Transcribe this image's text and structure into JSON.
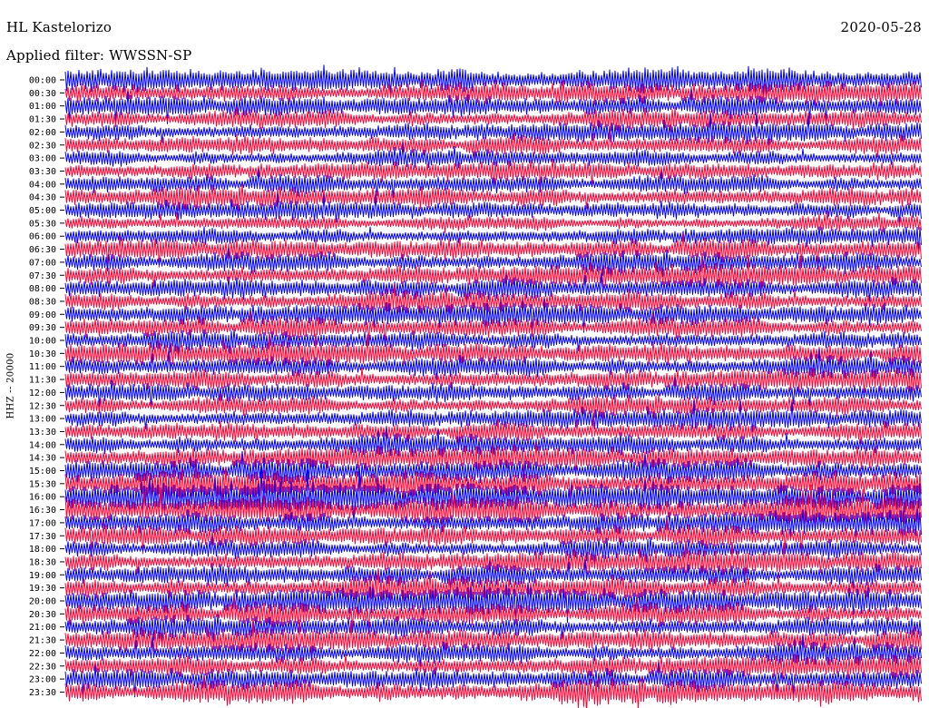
{
  "header": {
    "station": "HL Kastelorizo",
    "date": "2020-05-28",
    "filter": "Applied filter: WWSSN-SP"
  },
  "chart_data": {
    "type": "line",
    "ylabel": "HHZ -- 20000",
    "row_labels": [
      "00:00",
      "00:30",
      "01:00",
      "01:30",
      "02:00",
      "02:30",
      "03:00",
      "03:30",
      "04:00",
      "04:30",
      "05:00",
      "05:30",
      "06:00",
      "06:30",
      "07:00",
      "07:30",
      "08:00",
      "08:30",
      "09:00",
      "09:30",
      "10:00",
      "10:30",
      "11:00",
      "11:30",
      "12:00",
      "12:30",
      "13:00",
      "13:30",
      "14:00",
      "14:30",
      "15:00",
      "15:30",
      "16:00",
      "16:30",
      "17:00",
      "17:30",
      "18:00",
      "18:30",
      "19:00",
      "19:30",
      "20:00",
      "20:30",
      "21:00",
      "21:30",
      "22:00",
      "22:30",
      "23:00",
      "23:30"
    ],
    "colors": [
      "#0000ff",
      "#ff0033"
    ],
    "row_amplitude": [
      1.3,
      1.0,
      1.0,
      0.9,
      0.9,
      0.9,
      0.8,
      0.8,
      0.9,
      1.0,
      0.8,
      0.7,
      0.8,
      1.0,
      1.0,
      1.0,
      1.0,
      1.0,
      1.0,
      1.0,
      0.9,
      1.0,
      1.0,
      1.0,
      0.9,
      0.9,
      0.9,
      0.9,
      1.0,
      1.0,
      1.2,
      1.3,
      1.4,
      1.4,
      1.1,
      1.0,
      0.9,
      1.0,
      1.0,
      1.1,
      1.2,
      1.1,
      1.0,
      1.0,
      1.0,
      1.0,
      1.0,
      1.2
    ]
  }
}
